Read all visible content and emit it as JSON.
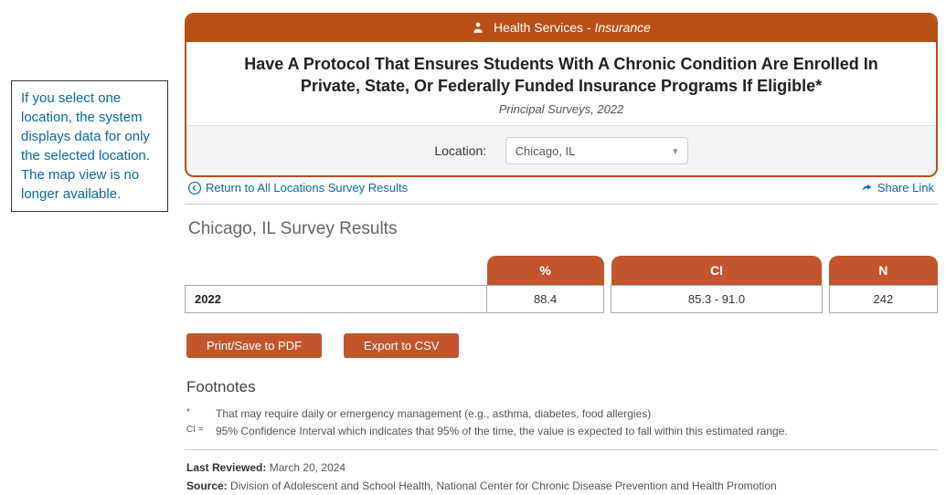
{
  "callout": {
    "text": "If you select one location, the system displays data for only the selected location. The map view is no longer available."
  },
  "header": {
    "category": "Health Services",
    "subcategory": "Insurance"
  },
  "title": "Have A Protocol That Ensures Students With A Chronic Condition Are Enrolled In Private, State, Or Federally Funded Insurance Programs If Eligible*",
  "subtitle": "Principal Surveys, 2022",
  "location": {
    "label": "Location:",
    "selected": "Chicago, IL"
  },
  "links": {
    "return": "Return to All Locations Survey Results",
    "share": "Share Link"
  },
  "results_title": "Chicago, IL Survey Results",
  "table": {
    "headers": [
      "%",
      "CI",
      "N"
    ],
    "rows": [
      {
        "year": "2022",
        "percent": "88.4",
        "ci": "85.3 - 91.0",
        "n": "242"
      }
    ]
  },
  "buttons": {
    "print": "Print/Save to PDF",
    "export": "Export to CSV"
  },
  "footnotes": {
    "title": "Footnotes",
    "items": [
      {
        "key": "*",
        "text": "That may require daily or emergency management (e.g., asthma, diabetes, food allergies)"
      },
      {
        "key": "CI =",
        "text": "95% Confidence Interval which indicates that 95% of the time, the value is expected to fall within this estimated range."
      }
    ]
  },
  "meta": {
    "last_reviewed_label": "Last Reviewed:",
    "last_reviewed": "March 20, 2024",
    "source_label": "Source:",
    "source": "Division of Adolescent and School Health, National Center for Chronic Disease Prevention and Health Promotion"
  }
}
